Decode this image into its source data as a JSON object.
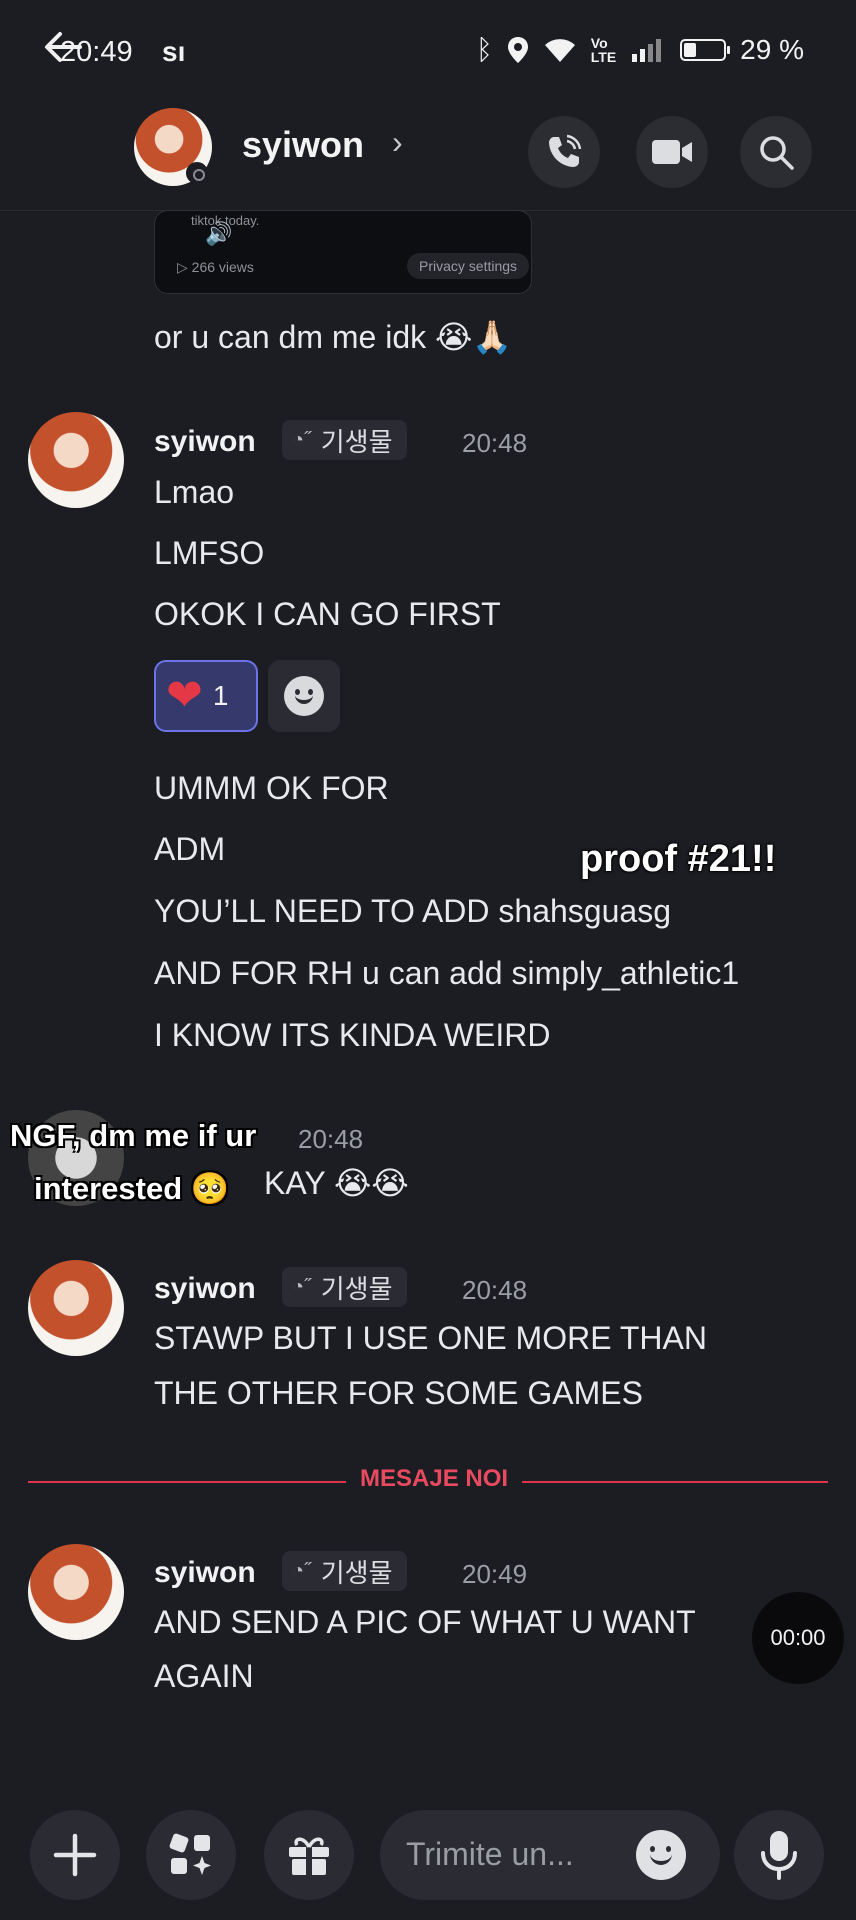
{
  "status_bar": {
    "time": "20:49",
    "carrier_icon": "sı",
    "battery": "29 %",
    "battery_level": 0.29,
    "icons": [
      "bluetooth-icon",
      "location-icon",
      "wifi-icon",
      "volte-icon",
      "signal-icon"
    ]
  },
  "header": {
    "username": "syiwon",
    "chevron": "›",
    "buttons": [
      "call-icon",
      "video-icon",
      "search-icon"
    ]
  },
  "video_embed": {
    "caption": "tiktok today.",
    "views": "266 views",
    "privacy_label": "Privacy settings"
  },
  "messages": {
    "pre": {
      "text": "or u can dm me idk",
      "emoji": "😭🙏🏻"
    },
    "group1": {
      "username": "syiwon",
      "tag": "기생물",
      "time": "20:48",
      "lines": [
        "Lmao",
        "LMFSO",
        "OKOK I CAN GO FIRST"
      ],
      "reaction": {
        "emoji": "❤",
        "count": "1"
      },
      "lines2": [
        "UMMM OK FOR",
        "ADM",
        "YOU’LL NEED TO ADD shahsguasg",
        "AND FOR RH u can add simply_athletic1",
        "I KNOW ITS KINDA WEIRD"
      ]
    },
    "group2": {
      "time": "20:48",
      "text": "KAY",
      "emoji": "😭😭"
    },
    "group3": {
      "username": "syiwon",
      "tag": "기생물",
      "time": "20:48",
      "lines": [
        "STAWP BUT I USE ONE MORE THAN",
        "THE OTHER FOR SOME GAMES"
      ]
    },
    "divider_label": "MESAJE NOI",
    "group4": {
      "username": "syiwon",
      "tag": "기생물",
      "time": "20:49",
      "lines": [
        "AND SEND A PIC OF WHAT U WANT",
        "AGAIN"
      ]
    }
  },
  "overlays": {
    "proof": "proof #21!!",
    "ngf_line1": "NGF, dm me if ur",
    "ngf_line2": "interested",
    "ngf_emoji": "🥺",
    "timer": "00:00"
  },
  "composer": {
    "placeholder": "Trimite un...",
    "buttons": [
      "plus-icon",
      "apps-icon",
      "gift-icon",
      "emoji-icon",
      "mic-icon"
    ]
  }
}
